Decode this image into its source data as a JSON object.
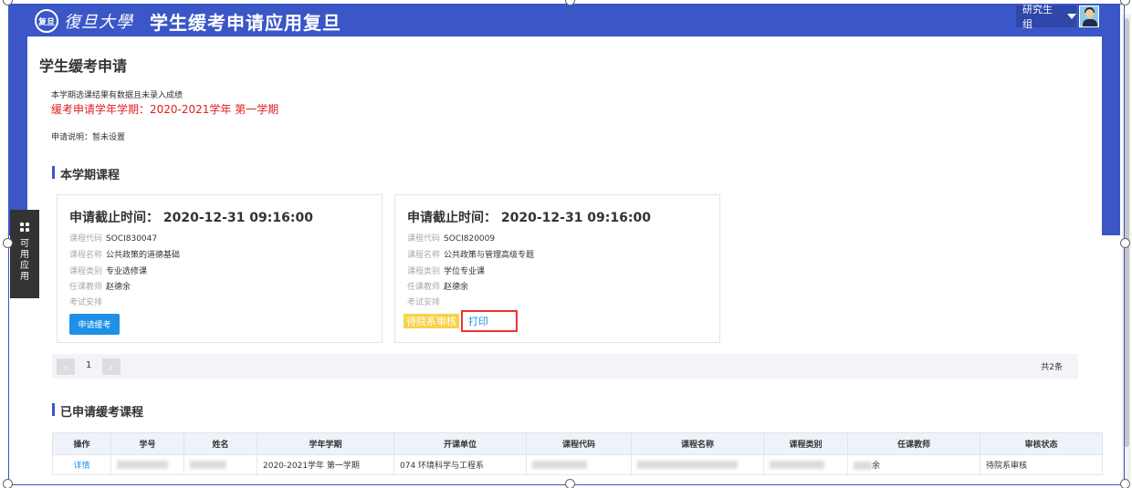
{
  "header": {
    "logo_seal": "复旦",
    "logo_text": "復旦大學",
    "app_title": "学生缓考申请应用复旦",
    "user_menu": "研究生组"
  },
  "page": {
    "title": "学生缓考申请",
    "notice": "本学期选课结果有数据且未录入成绩",
    "term_label": "缓考申请学年学期：2020-2021学年 第一学期",
    "description": "申请说明：暂未设置"
  },
  "current_courses": {
    "section_title": "本学期课程",
    "cards": [
      {
        "deadline": "申请截止时间： 2020-12-31 09:16:00",
        "rows": [
          {
            "k": "课程代码",
            "v": "SOCI830047"
          },
          {
            "k": "课程名称",
            "v": "公共政策的道德基础"
          },
          {
            "k": "课程类别",
            "v": "专业选修课"
          },
          {
            "k": "任课教师",
            "v": "赵德余"
          },
          {
            "k": "考试安排",
            "v": ""
          }
        ],
        "action_label": "申请缓考"
      },
      {
        "deadline": "申请截止时间： 2020-12-31 09:16:00",
        "rows": [
          {
            "k": "课程代码",
            "v": "SOCI820009"
          },
          {
            "k": "课程名称",
            "v": "公共政策与管理高级专题"
          },
          {
            "k": "课程类别",
            "v": "学位专业课"
          },
          {
            "k": "任课教师",
            "v": "赵德余"
          },
          {
            "k": "考试安排",
            "v": ""
          }
        ],
        "status_tag": "待院系审核",
        "print_label": "打印"
      }
    ],
    "pager": {
      "prev": "‹",
      "page": "1",
      "next": "›",
      "total": "共2条"
    }
  },
  "applied": {
    "section_title": "已申请缓考课程",
    "columns": [
      "操作",
      "学号",
      "姓名",
      "学年学期",
      "开课单位",
      "课程代码",
      "课程名称",
      "课程类别",
      "任课教师",
      "审核状态"
    ],
    "row": {
      "action": "详情",
      "term": "2020-2021学年 第一学期",
      "dept": "074 环境科学与工程系",
      "teacher_partial": "余",
      "status": "待院系审核"
    }
  },
  "side_widget": {
    "label": "可用应用"
  },
  "colors": {
    "primary": "#3a56c7",
    "link": "#1e90e8",
    "warning": "#f7d24a",
    "alert": "#e02020"
  }
}
